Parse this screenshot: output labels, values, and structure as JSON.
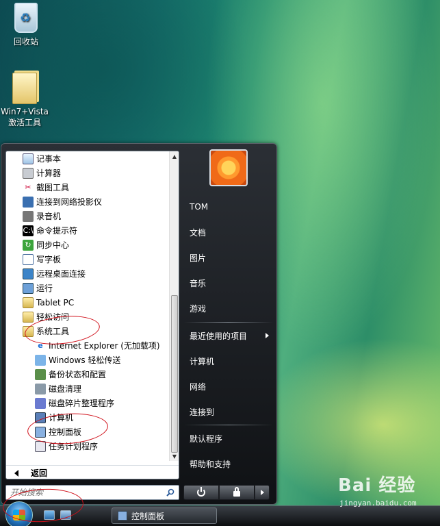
{
  "desktop": {
    "recycle_bin": "回收站",
    "folder_line1": "Win7+Vista",
    "folder_line2": "激活工具"
  },
  "start_menu": {
    "programs": [
      {
        "label": "记事本",
        "icon": "notepad-icon"
      },
      {
        "label": "计算器",
        "icon": "calculator-icon"
      },
      {
        "label": "截图工具",
        "icon": "snipping-tool-icon"
      },
      {
        "label": "连接到网络投影仪",
        "icon": "network-projector-icon"
      },
      {
        "label": "录音机",
        "icon": "sound-recorder-icon"
      },
      {
        "label": "命令提示符",
        "icon": "command-prompt-icon"
      },
      {
        "label": "同步中心",
        "icon": "sync-center-icon"
      },
      {
        "label": "写字板",
        "icon": "wordpad-icon"
      },
      {
        "label": "远程桌面连接",
        "icon": "remote-desktop-icon"
      },
      {
        "label": "运行",
        "icon": "run-icon"
      },
      {
        "label": "Tablet PC",
        "icon": "folder-icon"
      },
      {
        "label": "轻松访问",
        "icon": "folder-icon"
      },
      {
        "label": "系统工具",
        "icon": "folder-icon"
      }
    ],
    "system_tools": [
      {
        "label": "Internet Explorer (无加载项)",
        "icon": "internet-explorer-icon"
      },
      {
        "label": "Windows 轻松传送",
        "icon": "easy-transfer-icon"
      },
      {
        "label": "备份状态和配置",
        "icon": "backup-icon"
      },
      {
        "label": "磁盘清理",
        "icon": "disk-cleanup-icon"
      },
      {
        "label": "磁盘碎片整理程序",
        "icon": "defragmenter-icon"
      },
      {
        "label": "计算机",
        "icon": "computer-icon"
      },
      {
        "label": "控制面板",
        "icon": "control-panel-icon"
      },
      {
        "label": "任务计划程序",
        "icon": "task-scheduler-icon"
      }
    ],
    "back_label": "返回",
    "search_placeholder": "开始搜索",
    "right_items": {
      "user": "TOM",
      "documents": "文档",
      "pictures": "图片",
      "music": "音乐",
      "games": "游戏",
      "recent": "最近使用的项目",
      "computer": "计算机",
      "network": "网络",
      "connect": "连接到",
      "default_programs": "默认程序",
      "help": "帮助和支持"
    }
  },
  "taskbar": {
    "window_button": "控制面板"
  },
  "watermark": {
    "logo": "Bai 经验",
    "sub": "jingyan.baidu.com"
  }
}
